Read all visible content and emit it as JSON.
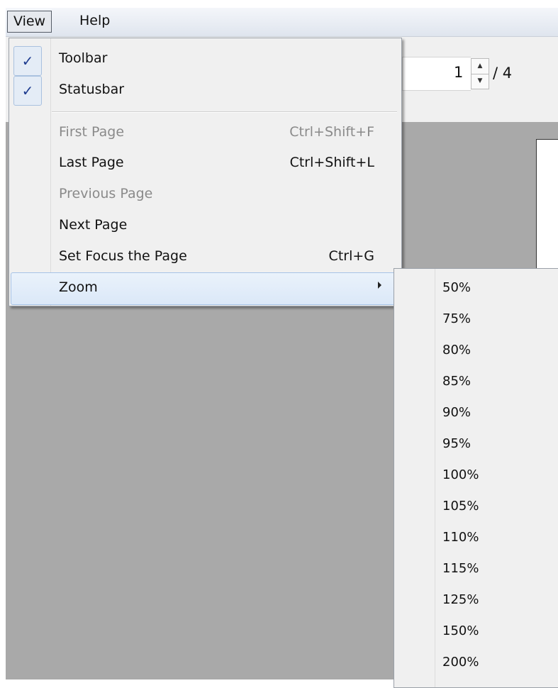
{
  "menubar": {
    "view": "View",
    "help": "Help"
  },
  "toolbar": {
    "page_value": "1",
    "page_total": "/ 4"
  },
  "view_menu": {
    "toolbar": {
      "label": "Toolbar",
      "checked": true
    },
    "statusbar": {
      "label": "Statusbar",
      "checked": true
    },
    "first_page": {
      "label": "First Page",
      "shortcut": "Ctrl+Shift+F",
      "enabled": false
    },
    "last_page": {
      "label": "Last Page",
      "shortcut": "Ctrl+Shift+L",
      "enabled": true
    },
    "previous_page": {
      "label": "Previous Page",
      "enabled": false
    },
    "next_page": {
      "label": "Next Page",
      "enabled": true
    },
    "set_focus": {
      "label": "Set Focus the Page",
      "shortcut": "Ctrl+G",
      "enabled": true
    },
    "zoom": {
      "label": "Zoom"
    }
  },
  "check_glyph": "✓",
  "zoom_menu": {
    "items": [
      "50%",
      "75%",
      "80%",
      "85%",
      "90%",
      "95%",
      "100%",
      "105%",
      "110%",
      "115%",
      "125%",
      "150%",
      "200%"
    ]
  }
}
